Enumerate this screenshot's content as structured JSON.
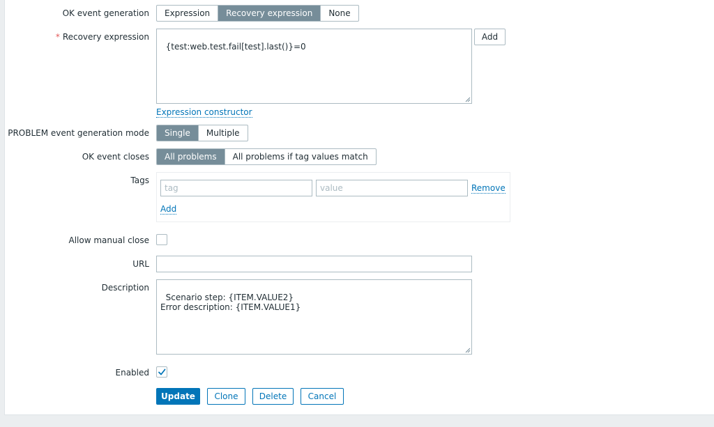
{
  "ok_event_generation": {
    "label": "OK event generation",
    "options": [
      "Expression",
      "Recovery expression",
      "None"
    ],
    "selected": "Recovery expression"
  },
  "recovery_expression": {
    "label": "Recovery expression",
    "value": "{test:web.test.fail[test].last()}=0",
    "add_label": "Add",
    "constructor_link": "Expression constructor"
  },
  "problem_mode": {
    "label": "PROBLEM event generation mode",
    "options": [
      "Single",
      "Multiple"
    ],
    "selected": "Single"
  },
  "ok_event_closes": {
    "label": "OK event closes",
    "options": [
      "All problems",
      "All problems if tag values match"
    ],
    "selected": "All problems"
  },
  "tags": {
    "label": "Tags",
    "tag_placeholder": "tag",
    "value_placeholder": "value",
    "remove_label": "Remove",
    "add_label": "Add"
  },
  "manual_close": {
    "label": "Allow manual close",
    "checked": false
  },
  "url": {
    "label": "URL",
    "value": ""
  },
  "description": {
    "label": "Description",
    "value": "Scenario step: {ITEM.VALUE2}\nError description: {ITEM.VALUE1}"
  },
  "enabled": {
    "label": "Enabled",
    "checked": true
  },
  "actions": {
    "update": "Update",
    "clone": "Clone",
    "delete": "Delete",
    "cancel": "Cancel"
  },
  "colors": {
    "accent": "#0275b8",
    "segment_active": "#768d99",
    "border": "#acbbc2",
    "required": "#e45959"
  }
}
